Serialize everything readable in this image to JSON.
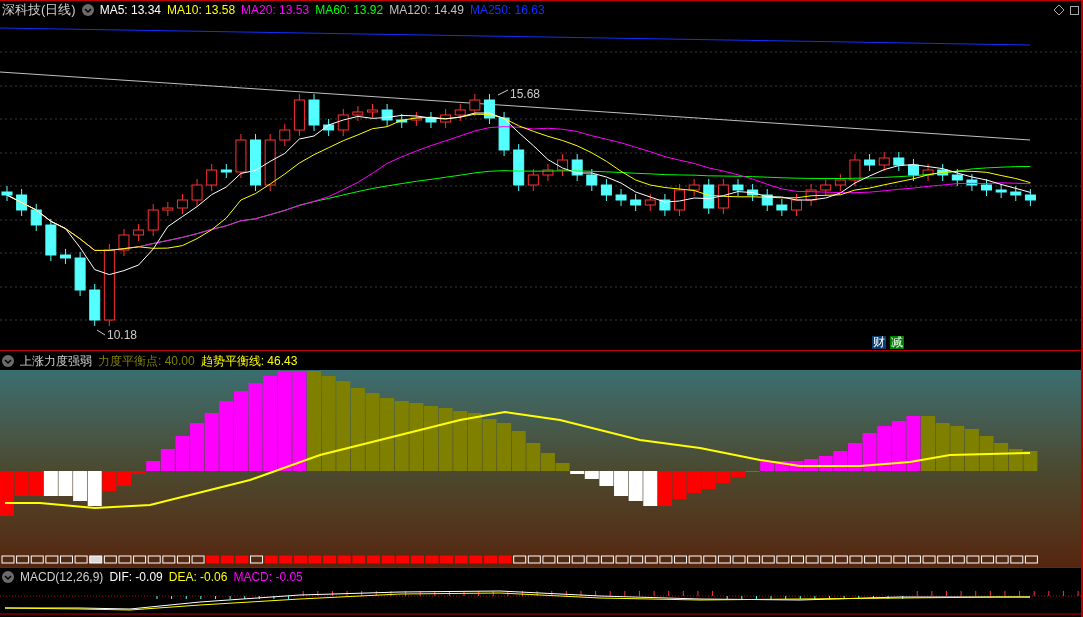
{
  "main_panel": {
    "title": "深科技(日线)",
    "indicators": [
      {
        "label": "MA5: 13.34",
        "color": "#ffffff"
      },
      {
        "label": "MA10: 13.58",
        "color": "#ffff00"
      },
      {
        "label": "MA20: 13.53",
        "color": "#ff00ff"
      },
      {
        "label": "MA60: 13.92",
        "color": "#00ff00"
      },
      {
        "label": "MA120: 14.49",
        "color": "#c0c0c0"
      },
      {
        "label": "MA250: 16.63",
        "color": "#1030ff"
      }
    ],
    "high_label": "15.68",
    "low_label": "10.18",
    "badges": [
      {
        "text": "财",
        "color": "#0a3a6e"
      },
      {
        "text": "减",
        "color": "#008000"
      }
    ]
  },
  "strength_panel": {
    "title": "上涨力度强弱",
    "readouts": [
      {
        "label": "力度平衡点: 40.00",
        "color": "#808000"
      },
      {
        "label": "趋势平衡线: 46.43",
        "color": "#ffff00"
      }
    ],
    "signal_row": [
      {
        "kind": "empty"
      },
      {
        "kind": "empty"
      },
      {
        "kind": "empty"
      },
      {
        "kind": "empty"
      },
      {
        "kind": "empty"
      },
      {
        "kind": "empty"
      },
      {
        "kind": "white"
      },
      {
        "kind": "empty"
      },
      {
        "kind": "empty"
      },
      {
        "kind": "empty"
      },
      {
        "kind": "empty"
      },
      {
        "kind": "empty"
      },
      {
        "kind": "empty"
      },
      {
        "kind": "empty"
      },
      {
        "kind": "red"
      },
      {
        "kind": "red"
      },
      {
        "kind": "red"
      },
      {
        "kind": "empty"
      },
      {
        "kind": "red"
      },
      {
        "kind": "red"
      },
      {
        "kind": "red"
      },
      {
        "kind": "red"
      },
      {
        "kind": "red"
      },
      {
        "kind": "red"
      },
      {
        "kind": "red"
      },
      {
        "kind": "red"
      },
      {
        "kind": "red"
      },
      {
        "kind": "red"
      },
      {
        "kind": "red"
      },
      {
        "kind": "red"
      },
      {
        "kind": "red"
      },
      {
        "kind": "red"
      },
      {
        "kind": "red"
      },
      {
        "kind": "red"
      },
      {
        "kind": "red"
      },
      {
        "kind": "empty"
      },
      {
        "kind": "empty"
      },
      {
        "kind": "empty"
      },
      {
        "kind": "empty"
      },
      {
        "kind": "empty"
      },
      {
        "kind": "empty"
      },
      {
        "kind": "empty"
      },
      {
        "kind": "empty"
      },
      {
        "kind": "empty"
      },
      {
        "kind": "empty"
      },
      {
        "kind": "empty"
      },
      {
        "kind": "empty"
      },
      {
        "kind": "empty"
      },
      {
        "kind": "empty"
      },
      {
        "kind": "empty"
      },
      {
        "kind": "empty"
      },
      {
        "kind": "empty"
      },
      {
        "kind": "empty"
      },
      {
        "kind": "empty"
      },
      {
        "kind": "empty"
      },
      {
        "kind": "empty"
      },
      {
        "kind": "empty"
      },
      {
        "kind": "empty"
      },
      {
        "kind": "empty"
      },
      {
        "kind": "empty"
      },
      {
        "kind": "empty"
      },
      {
        "kind": "empty"
      },
      {
        "kind": "empty"
      },
      {
        "kind": "empty"
      },
      {
        "kind": "empty"
      },
      {
        "kind": "empty"
      },
      {
        "kind": "empty"
      },
      {
        "kind": "empty"
      },
      {
        "kind": "empty"
      },
      {
        "kind": "empty"
      },
      {
        "kind": "empty"
      }
    ]
  },
  "macd_panel": {
    "title": "MACD(12,26,9)",
    "readouts": [
      {
        "label": "DIF: -0.09",
        "color": "#ffffff"
      },
      {
        "label": "DEA: -0.06",
        "color": "#ffff00"
      },
      {
        "label": "MACD: -0.05",
        "color": "#ff00ff"
      }
    ]
  }
}
